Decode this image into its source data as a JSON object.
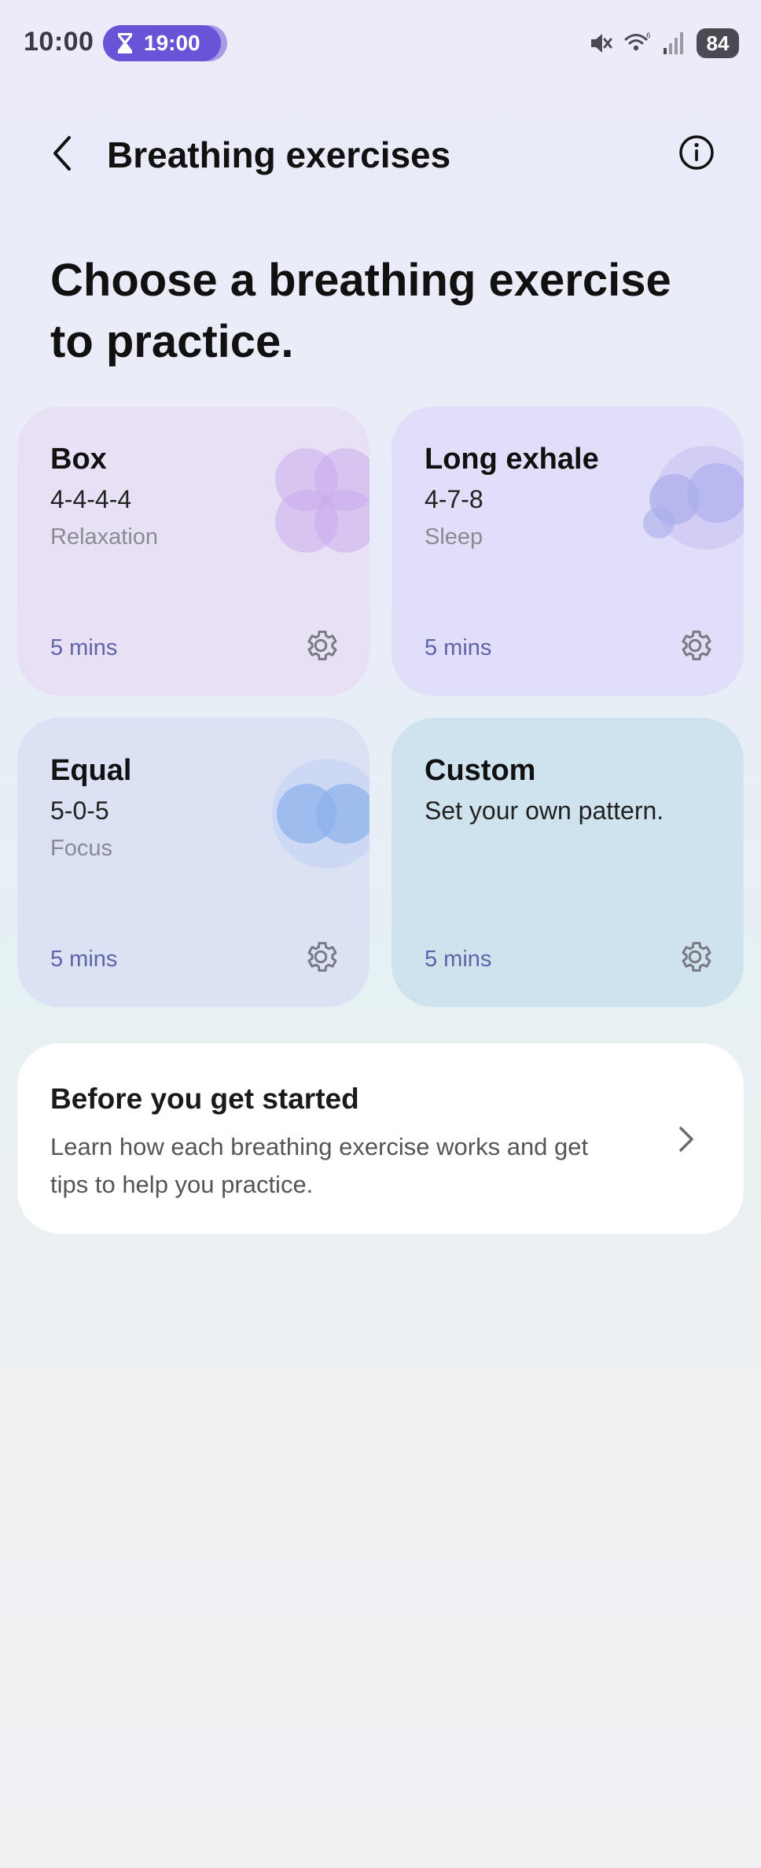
{
  "status_bar": {
    "time": "10:00",
    "timer": "19:00",
    "battery": "84",
    "icons": [
      "hourglass-icon",
      "mute-icon",
      "wifi-icon",
      "signal-icon"
    ]
  },
  "header": {
    "title": "Breathing exercises",
    "back_icon": "chevron-left-icon",
    "info_icon": "info-icon"
  },
  "headline": "Choose a breathing exercise to practice.",
  "exercises": [
    {
      "title": "Box",
      "pattern": "4-4-4-4",
      "type": "Relaxation",
      "duration": "5 mins"
    },
    {
      "title": "Long exhale",
      "pattern": "4-7-8",
      "type": "Sleep",
      "duration": "5 mins"
    },
    {
      "title": "Equal",
      "pattern": "5-0-5",
      "type": "Focus",
      "duration": "5 mins"
    },
    {
      "title": "Custom",
      "pattern": "Set your own pattern.",
      "duration": "5 mins"
    }
  ],
  "info_card": {
    "title": "Before you get started",
    "description": "Learn how each breathing exercise works and get tips to help you practice."
  },
  "colors": {
    "accent": "#6754d6",
    "duration_text": "#5f63a8",
    "box_card": "#e8e1f5",
    "long_exhale_card": "#e0def8",
    "equal_card": "#dbe2f4",
    "custom_card": "#cfe3ef"
  }
}
